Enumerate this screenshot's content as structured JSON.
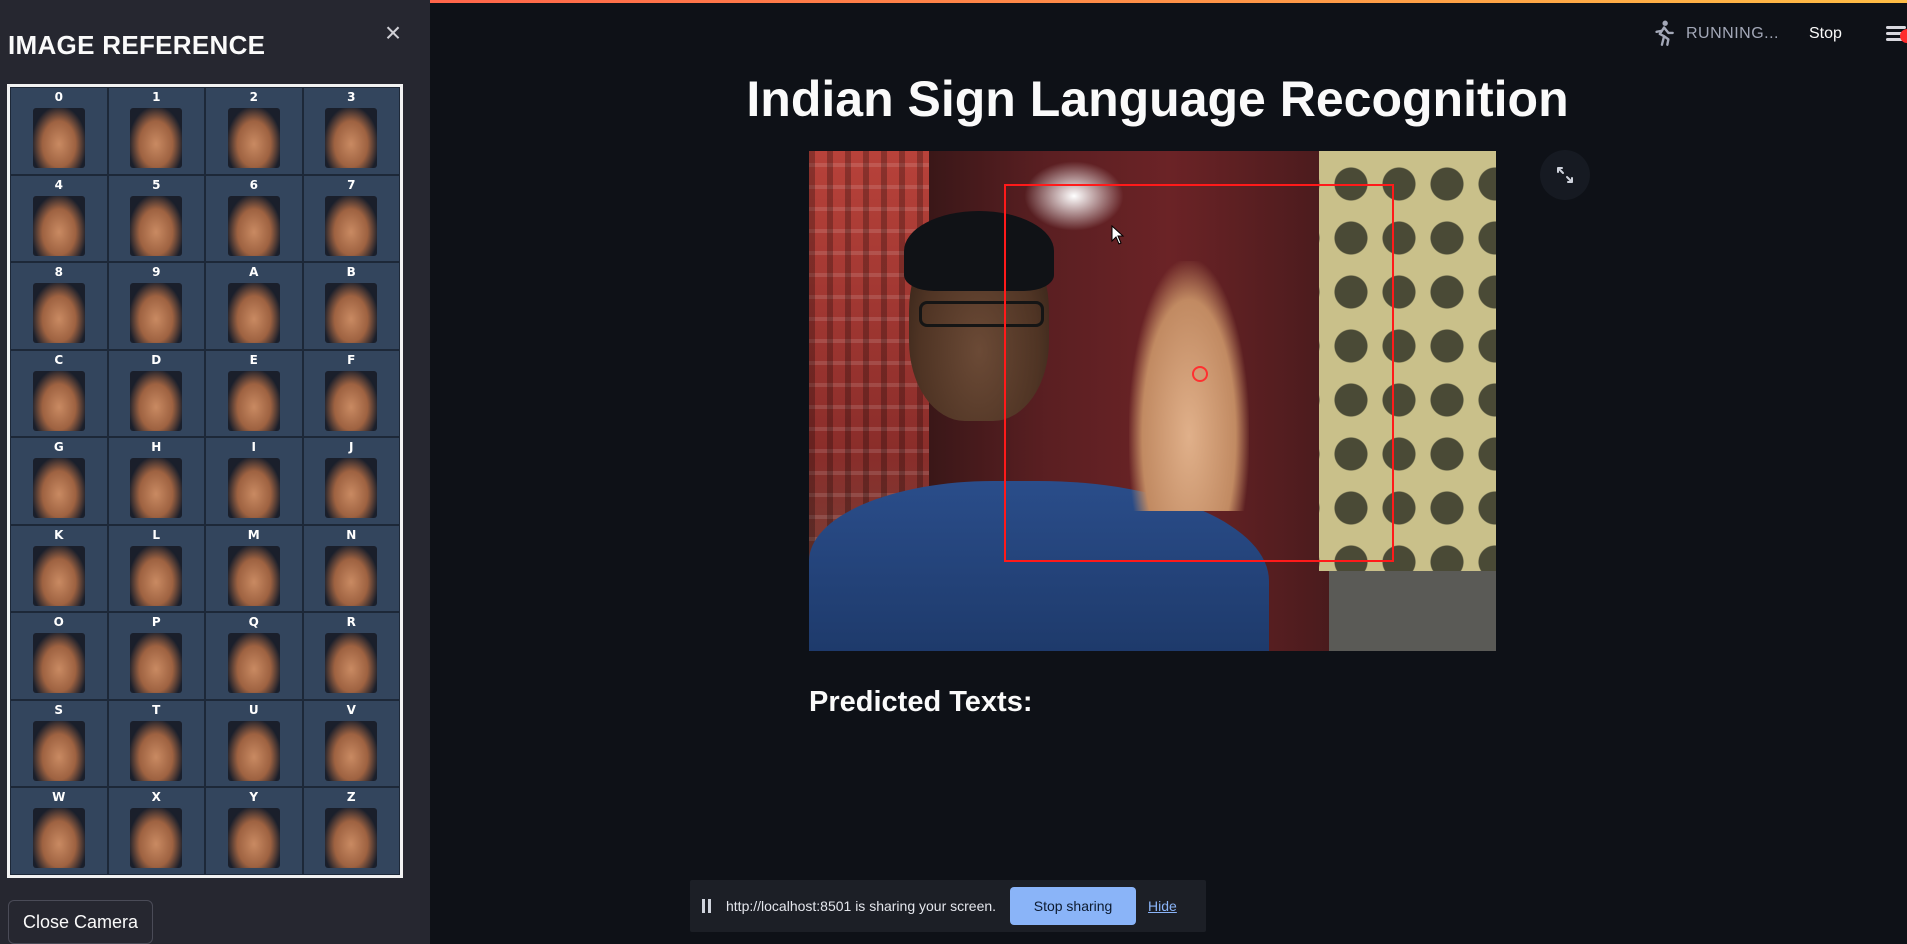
{
  "sidebar": {
    "title": "IMAGE REFERENCE",
    "close_icon": "×",
    "close_camera_label": "Close Camera",
    "reference_labels": [
      "0",
      "1",
      "2",
      "3",
      "4",
      "5",
      "6",
      "7",
      "8",
      "9",
      "A",
      "B",
      "C",
      "D",
      "E",
      "F",
      "G",
      "H",
      "I",
      "J",
      "K",
      "L",
      "M",
      "N",
      "O",
      "P",
      "Q",
      "R",
      "S",
      "T",
      "U",
      "V",
      "W",
      "X",
      "Y",
      "Z"
    ]
  },
  "header": {
    "status_text": "RUNNING...",
    "stop_label": "Stop",
    "running_icon": "running-man-icon",
    "menu_icon": "hamburger-menu-icon"
  },
  "main": {
    "title": "Indian Sign Language Recognition",
    "camera_feed": "webcam-feed",
    "fullscreen_icon": "expand-arrows-icon",
    "predicted_label": "Predicted Texts:"
  },
  "share_bar": {
    "text": "http://localhost:8501 is sharing your screen.",
    "stop_sharing_label": "Stop sharing",
    "hide_label": "Hide"
  },
  "colors": {
    "background": "#0e1117",
    "sidebar": "#262730",
    "accent": "#ff4b4b",
    "share_button": "#8ab4f8"
  }
}
